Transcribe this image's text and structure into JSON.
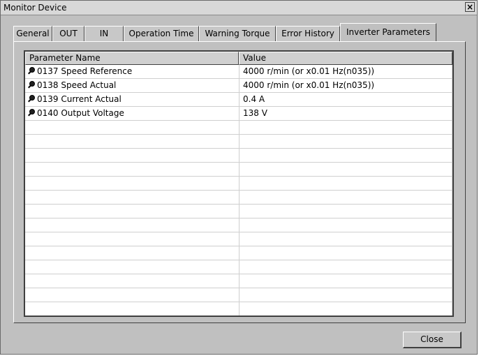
{
  "window": {
    "title": "Monitor Device"
  },
  "tabs": [
    {
      "label": "General"
    },
    {
      "label": "OUT"
    },
    {
      "label": "IN"
    },
    {
      "label": "Operation Time"
    },
    {
      "label": "Warning Torque"
    },
    {
      "label": "Error History"
    },
    {
      "label": "Inverter Parameters",
      "active": true
    }
  ],
  "table": {
    "columns": [
      "Parameter Name",
      "Value",
      ""
    ],
    "rows": [
      {
        "name": "0137 Speed Reference",
        "value": "4000 r/min  (or x0.01 Hz(n035))",
        "icon": "parameter-icon"
      },
      {
        "name": "0138 Speed Actual",
        "value": "4000 r/min  (or x0.01 Hz(n035))",
        "icon": "parameter-icon"
      },
      {
        "name": "0139 Current Actual",
        "value": "0.4 A",
        "icon": "parameter-icon"
      },
      {
        "name": "0140 Output Voltage",
        "value": "138 V",
        "icon": "parameter-icon"
      }
    ]
  },
  "buttons": {
    "close": "Close"
  }
}
